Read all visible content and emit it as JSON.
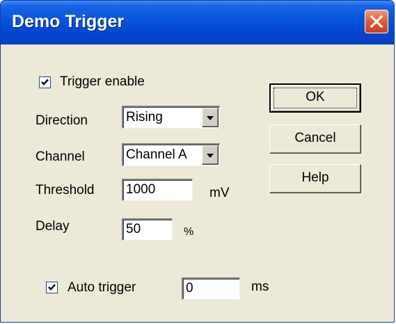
{
  "window": {
    "title": "Demo Trigger"
  },
  "form": {
    "trigger_enable": {
      "label": "Trigger enable",
      "checked": true
    },
    "direction": {
      "label": "Direction",
      "value": "Rising"
    },
    "channel": {
      "label": "Channel",
      "value": "Channel A"
    },
    "threshold": {
      "label": "Threshold",
      "value": "1000",
      "unit": "mV"
    },
    "delay": {
      "label": "Delay",
      "value": "50",
      "unit": "%"
    },
    "auto_trigger": {
      "label": "Auto trigger",
      "checked": true,
      "value": "0",
      "unit": "ms"
    }
  },
  "buttons": {
    "ok": "OK",
    "cancel": "Cancel",
    "help": "Help"
  },
  "icons": {
    "close": "close-icon",
    "checkmark": "checkmark-icon",
    "dropdown": "dropdown-arrow-icon"
  },
  "colors": {
    "titlebar": "#0a55dd",
    "close_button": "#e0603c",
    "dialog_background": "#ece9d8"
  }
}
